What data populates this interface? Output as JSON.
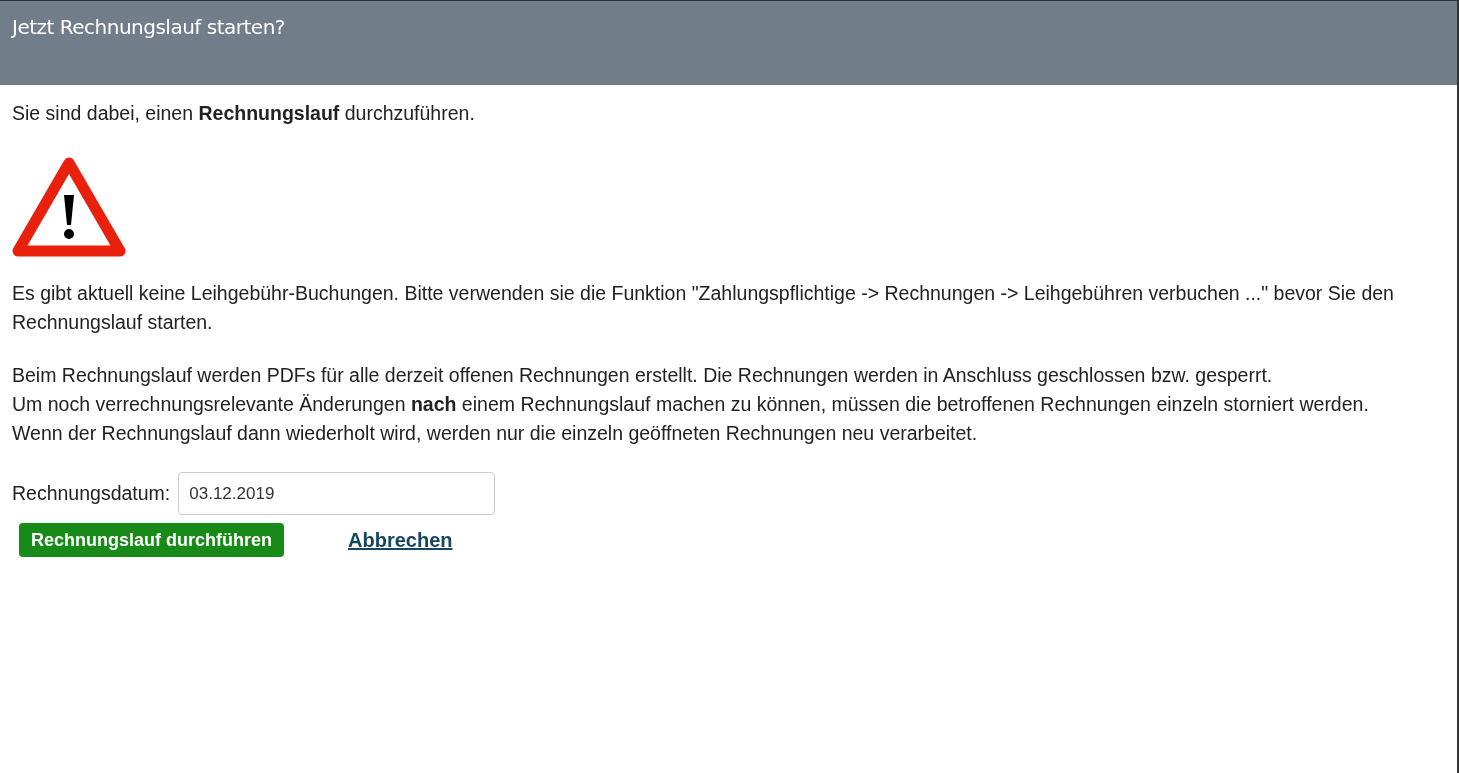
{
  "dialog": {
    "title": "Jetzt Rechnungslauf starten?",
    "intro": "Sie sind dabei, einen **Rechnungslauf** durchzuführen.",
    "warning": "Es gibt aktuell keine Leihgebühr-Buchungen. Bitte verwenden sie die Funktion \"Zahlungspflichtige -> Rechnungen -> Leihgebühren verbuchen ...\" bevor Sie den Rechnungslauf starten.",
    "info_lines": [
      "Beim Rechnungslauf werden PDFs für alle derzeit offenen Rechnungen erstellt. Die Rechnungen werden in Anschluss geschlossen bzw. gesperrt.",
      "Um noch verrechnungsrelevante Änderungen **nach** einem Rechnungslauf machen zu können, müssen die betroffenen Rechnungen einzeln storniert werden.",
      "Wenn der Rechnungslauf dann wiederholt wird, werden nur die einzeln geöffneten Rechnungen neu verarbeitet."
    ],
    "date_field": {
      "label": "Rechnungsdatum:",
      "value": "03.12.2019"
    },
    "submit_button": "Rechnungslauf durchführen",
    "cancel_link": "Abbrechen"
  }
}
